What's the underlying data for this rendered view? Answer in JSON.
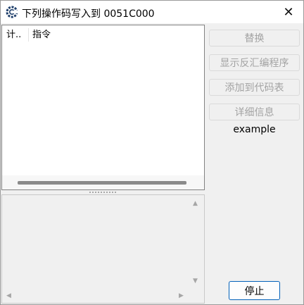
{
  "window": {
    "title": "下列操作码写入到 0051C000",
    "close_glyph": "✕"
  },
  "list": {
    "columns": [
      "计..",
      "指令"
    ],
    "rows": []
  },
  "buttons": {
    "replace": "替换",
    "show_disassembler": "显示反汇编程序",
    "add_to_code_table": "添加到代码表",
    "details": "详细信息",
    "stop": "停止"
  },
  "status_label": "example",
  "scroll_arrows": {
    "up": "▲",
    "down": "▼",
    "left": "◀",
    "right": "▶"
  },
  "colors": {
    "accent": "#005fb8",
    "disabled_text": "#a3a3a3",
    "icon": "#1f3f6b"
  }
}
